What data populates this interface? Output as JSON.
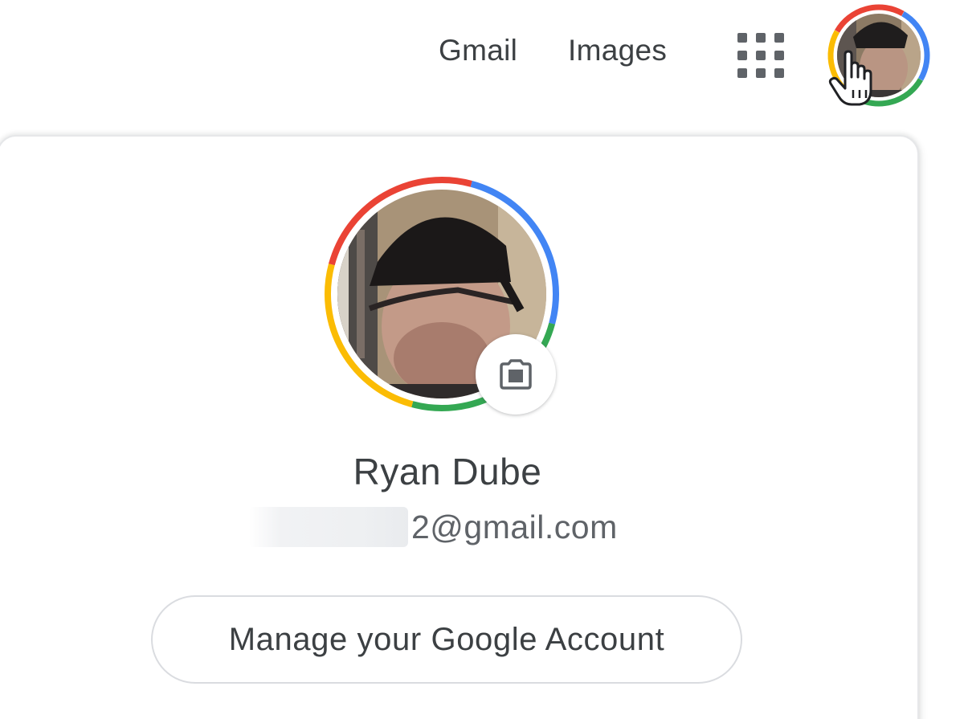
{
  "header": {
    "links": [
      {
        "label": "Gmail"
      },
      {
        "label": "Images"
      }
    ],
    "apps_icon": "google-apps-grid-icon",
    "account_avatar_icon": "account-avatar-photo"
  },
  "account_menu": {
    "name": "Ryan Dube",
    "email_visible": "2@gmail.com",
    "email_prefix_redacted": true,
    "change_photo_icon": "camera-icon",
    "manage_button_label": "Manage your Google Account"
  },
  "colors": {
    "google_red": "#ea4335",
    "google_blue": "#4285f4",
    "google_green": "#34a853",
    "google_yellow": "#fbbc04",
    "text_primary": "#3c4043",
    "text_secondary": "#5f6368",
    "border": "#dadce0"
  }
}
